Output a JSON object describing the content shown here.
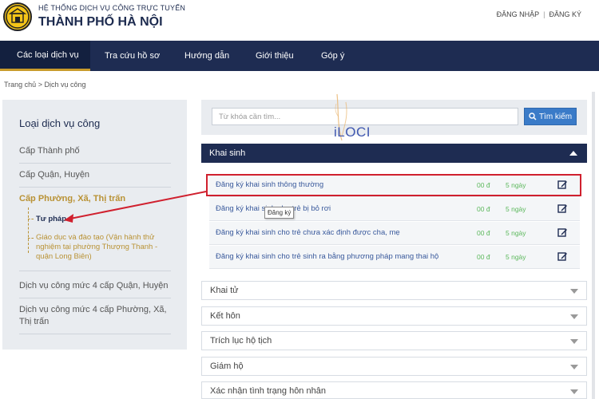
{
  "header": {
    "subtitle": "HỆ THỐNG DỊCH VỤ CÔNG TRỰC TUYẾN",
    "title": "THÀNH PHỐ HÀ NỘI",
    "login": "ĐĂNG NHẬP",
    "separator": "|",
    "register": "ĐĂNG KÝ"
  },
  "nav": {
    "items": [
      {
        "label": "Các loại dịch vụ"
      },
      {
        "label": "Tra cứu hồ sơ"
      },
      {
        "label": "Hướng dẫn"
      },
      {
        "label": "Giới thiệu"
      },
      {
        "label": "Góp ý"
      }
    ]
  },
  "breadcrumb": {
    "home": "Trang chủ",
    "sep": ">",
    "current": "Dịch vụ công"
  },
  "sidebar": {
    "title": "Loại dịch vụ công",
    "items": [
      {
        "label": "Cấp Thành phố"
      },
      {
        "label": "Cấp Quận, Huyện"
      },
      {
        "label": "Cấp Phường, Xã, Thị trấn"
      },
      {
        "label": "Dịch vụ công mức 4 cấp Quận, Huyện"
      },
      {
        "label": "Dịch vụ công mức 4 cấp Phường, Xã, Thị trấn"
      }
    ],
    "subitems": [
      {
        "label": "Tư pháp"
      },
      {
        "label": "Giáo dục và đào tạo (Vận hành thử nghiệm tại phường Thượng Thanh - quận Long Biên)"
      }
    ]
  },
  "search": {
    "placeholder": "Từ khóa cần tìm...",
    "button_label": "Tìm kiếm"
  },
  "watermark": "iLOCI",
  "category_open": "Khai sinh",
  "services": [
    {
      "name": "Đăng ký khai sinh thông thường",
      "fee": "00 đ",
      "days": "5 ngày"
    },
    {
      "name": "Đăng ký khai sinh cho trẻ bị bỏ rơi",
      "fee": "00 đ",
      "days": "5 ngày"
    },
    {
      "name": "Đăng ký khai sinh cho trẻ chưa xác định được cha, mẹ",
      "fee": "00 đ",
      "days": "5 ngày"
    },
    {
      "name": "Đăng ký khai sinh cho trẻ sinh ra bằng phương pháp mang thai hộ",
      "fee": "00 đ",
      "days": "5 ngày"
    }
  ],
  "tooltip": "Đăng ký",
  "categories": [
    {
      "label": "Khai tử"
    },
    {
      "label": "Kết hôn"
    },
    {
      "label": "Trích lục hộ tịch"
    },
    {
      "label": "Giám hộ"
    },
    {
      "label": "Xác nhận tình trạng hôn nhân"
    }
  ],
  "colors": {
    "nav_bg": "#1e2c52",
    "accent_gold": "#b99235",
    "link_blue": "#3a5a9c",
    "price_green": "#5cb85c",
    "highlight_red": "#d0202e",
    "search_button": "#3a7bc8"
  }
}
